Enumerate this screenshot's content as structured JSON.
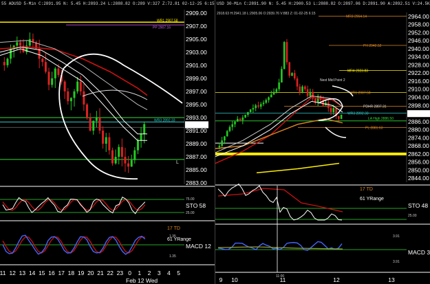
{
  "left": {
    "header": "55 ADUSD 5-Min C:2891.95 N: 5.45 H:2893.24 L:2888.82 O:289 V:327 Z:72.81 02-12-25 6:15",
    "price_ticks": [
      "2909.00",
      "2907.00",
      "2905.00",
      "2903.00",
      "2901.00",
      "2899.00",
      "2897.00",
      "2895.00",
      "2893.00",
      "2891.00",
      "2889.00",
      "2887.00",
      "2885.00",
      "2883.00"
    ],
    "last_price": "2891.90",
    "level_labels": [
      "WR1 2907.58",
      "PP 2907.16",
      "WR3 2892.33"
    ],
    "lower_labels": {
      "td": "17 TD",
      "range": "61 YRange",
      "sto": "STO 58",
      "macd": "MACD 12",
      "sto_values": [
        "75.00",
        "25.00"
      ],
      "macd_values": [
        "1.35",
        "1.35"
      ]
    },
    "x_labels": [
      "11",
      "12",
      "13",
      "14",
      "15",
      "16",
      "17",
      "18",
      "19",
      "20",
      "21",
      "22",
      "23",
      "0",
      "1",
      "2",
      "3",
      "4",
      "5"
    ],
    "date_label": "Feb 12 Wed",
    "footer_mark": "L"
  },
  "right": {
    "header": "USD 30-Min C:2891.90 N: 5.45 H:2900.53 L:2888.82 O:2897.06 D:2891.90 A:2892.51 V:24.5K OI:0",
    "sub_header": "2918.63 H:2941.18 L:2905.06 O:2939.76 V:883 Z: 01-02-25 6:15",
    "price_ticks": [
      "2964.00",
      "2958.00",
      "2952.00",
      "2946.00",
      "2940.00",
      "2934.00",
      "2928.00",
      "2922.00",
      "2916.00",
      "2910.00",
      "2904.00",
      "2898.00",
      "2892.00",
      "2886.00",
      "2880.00",
      "2874.00",
      "2868.00",
      "2862.00",
      "2856.00",
      "2850.00",
      "2844.00"
    ],
    "last_price": "2891.90",
    "level_labels": [
      "MR3 2964.14",
      "PH 2942.52",
      "MR4 2923.83",
      "Next Mid Point 2",
      "WR1 2907.58",
      "PDHR 2897.31",
      "WR3 2892.33",
      "LA High 2886.50",
      "PL 2881.63"
    ],
    "lower_labels": {
      "td": "17 TD",
      "range": "61 YRange",
      "sto": "STO 48",
      "macd": "MACD 3",
      "sto_values": [
        "75.00",
        "25.00"
      ],
      "macd_values": [
        "3.91",
        "3.91"
      ]
    },
    "x_labels": [
      "9",
      "10",
      "11",
      "12",
      "13"
    ],
    "x_small": "11:00"
  },
  "colors": {
    "bull": "#22cc22",
    "bear": "#dd2222",
    "ma_red": "#cc1111",
    "yellow": "#ffee00",
    "cyan": "#33cccc",
    "lime": "#33dd33",
    "white": "#ffffff",
    "orange": "#dd8822",
    "olive": "#999933"
  }
}
